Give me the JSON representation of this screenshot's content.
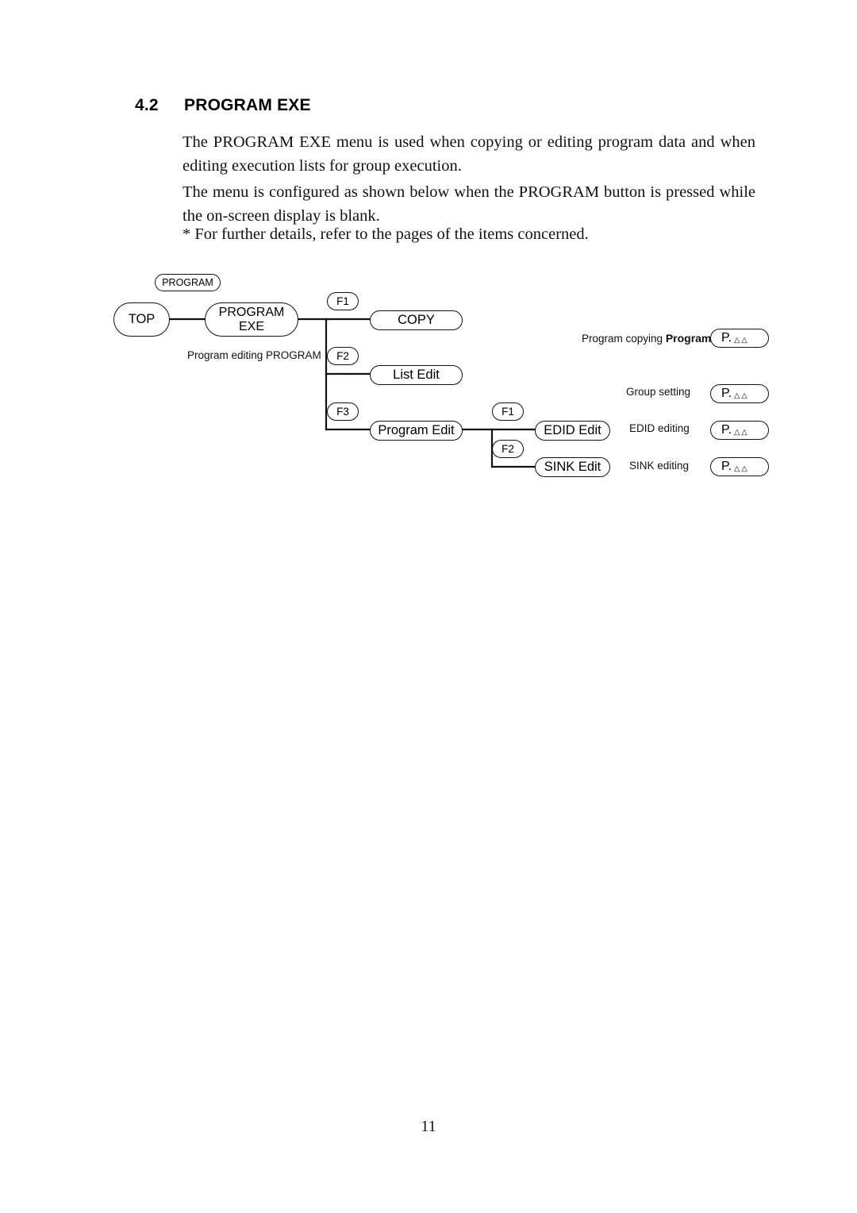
{
  "page": {
    "folio": "11"
  },
  "heading": {
    "number": "4.2",
    "title": "PROGRAM EXE"
  },
  "body": {
    "paragraph_1": "The PROGRAM EXE menu is used when copying or editing program data and when editing execution lists for group execution.",
    "paragraph_2": "The menu is configured as shown below when the PROGRAM button is pressed while the on-screen display is blank.",
    "paragraph_3": "* For further details, refer to the pages of the items concerned."
  },
  "diagram": {
    "nodes": {
      "program_button": "PROGRAM",
      "top": "TOP",
      "program_exe": "PROGRAM\nEXE",
      "copy": "COPY",
      "list_edit": "List Edit",
      "program_edit": "Program Edit",
      "edid_edit": "EDID Edit",
      "sink_edit": "SINK Edit"
    },
    "keys": {
      "f1_copy": "F1",
      "f2_list": "F2",
      "f3_program": "F3",
      "f1_edid": "F1",
      "f2_sink": "F2"
    },
    "captions": {
      "program_editing": "Program editing PROGRAM",
      "program_copying": "Program copying ",
      "program_copying_bold": "Program",
      "group_setting": "Group setting",
      "edid_editing": "EDID editing",
      "sink_editing": "SINK editing"
    },
    "page_refs": {
      "copy_ref": "P.",
      "copy_ref_marks": "△△",
      "list_ref": "P.",
      "list_ref_marks": "△△",
      "edid_ref": "P.",
      "edid_ref_marks": "△△",
      "sink_ref": "P.",
      "sink_ref_marks": "△△"
    }
  }
}
